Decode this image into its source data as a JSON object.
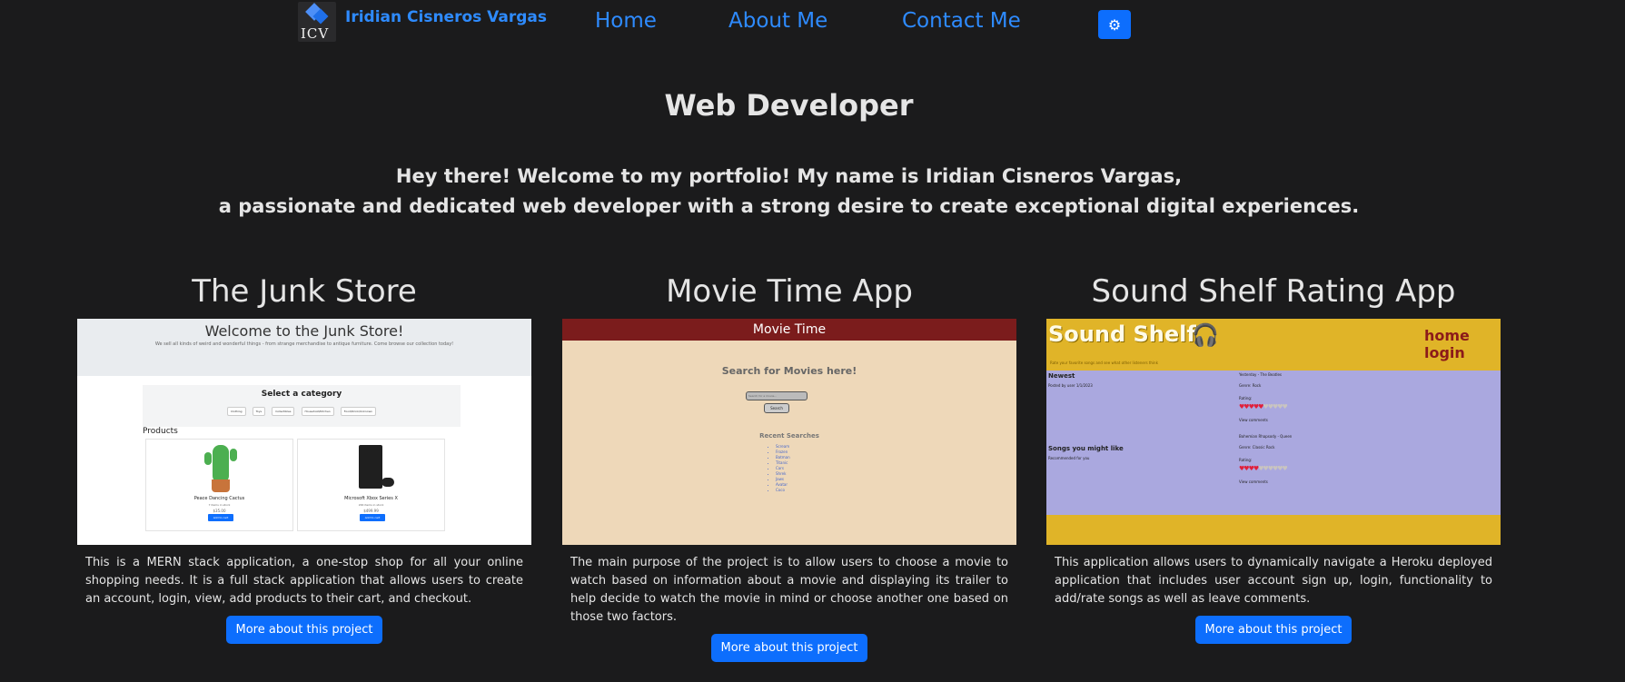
{
  "nav": {
    "logo_letters": "ICV",
    "brand": "Iridian Cisneros Vargas",
    "links": [
      "Home",
      "About Me",
      "Contact Me"
    ],
    "theme_icon": "gear-icon"
  },
  "hero": {
    "title": "Web Developer",
    "intro_line1": "Hey there! Welcome to my portfolio! My name is Iridian Cisneros Vargas,",
    "intro_line2": "a passionate and dedicated web developer with a strong desire to create exceptional digital experiences."
  },
  "projects": [
    {
      "title": "The Junk Store",
      "description": "This is a MERN stack application, a one-stop shop for all your online shopping needs. It is a full stack application that allows users to create an account, login, view, add products to their cart, and checkout.",
      "button": "More about this project",
      "screenshot": {
        "heading": "Welcome to the Junk Store!",
        "subheading": "We sell all kinds of weird and wonderful things - from strange merchandise to antique furniture. Come browse our collection today!",
        "category_title": "Select a category",
        "categories": [
          "Clothing",
          "Toys",
          "Collectibles",
          "Household/Kitchen",
          "Food/Drink/Unknown"
        ],
        "products_label": "Products",
        "items": [
          {
            "name": "Peace Dancing Cactus",
            "stock": "7 items in stock",
            "price": "$35.00",
            "button": "Add to cart"
          },
          {
            "name": "Microsoft Xbox Series X",
            "stock": "200 items in stock",
            "price": "$499.99",
            "button": "Add to cart"
          }
        ]
      }
    },
    {
      "title": "Movie Time App",
      "description": "The main purpose of the project is to allow users to choose a movie to watch based on information about a movie and displaying its trailer to help decide to watch the movie in mind or choose another one based on those two factors.",
      "button": "More about this project",
      "screenshot": {
        "bar_title": "Movie Time",
        "search_title": "Search for Movies here!",
        "input_placeholder": "Search for a movie...",
        "search_button": "Search",
        "recent_title": "Recent Searches",
        "recent": [
          "Scream",
          "Frozen",
          "Batman",
          "Titanic",
          "Cars",
          "Shrek",
          "Jaws",
          "Avatar",
          "Coco"
        ]
      }
    },
    {
      "title": "Sound Shelf Rating App",
      "description": "This application allows users to dynamically navigate a Heroku deployed application that includes user account sign up, login, functionality to add/rate songs as well as leave comments.",
      "button": "More about this project",
      "screenshot": {
        "logo": "Sound Shelf",
        "logo_icon": "headphones-icon",
        "nav_text": "home login",
        "top_text": "Rate your favorite songs and see what other listeners think",
        "left_heading_1": "Newest",
        "left_line_1": "Posted by user 1/1/2023",
        "left_heading_2": "Songs you might like",
        "left_line_2": "Recommended for you",
        "song_1": "Yesterday - The Beatles",
        "genre_1": "Genre: Rock",
        "rating_1": "Rating:",
        "hearts_1": "♥♥♥♥♥♥♥♥♥♥",
        "comments_1": "View comments",
        "song_2": "Bohemian Rhapsody - Queen",
        "genre_2": "Genre: Classic Rock",
        "rating_2": "Rating:",
        "hearts_2": "♥♥♥♥♥♥♥♥♥♥",
        "comments_2": "View comments",
        "rating_level_1": 5,
        "rating_level_2": 4
      }
    }
  ]
}
